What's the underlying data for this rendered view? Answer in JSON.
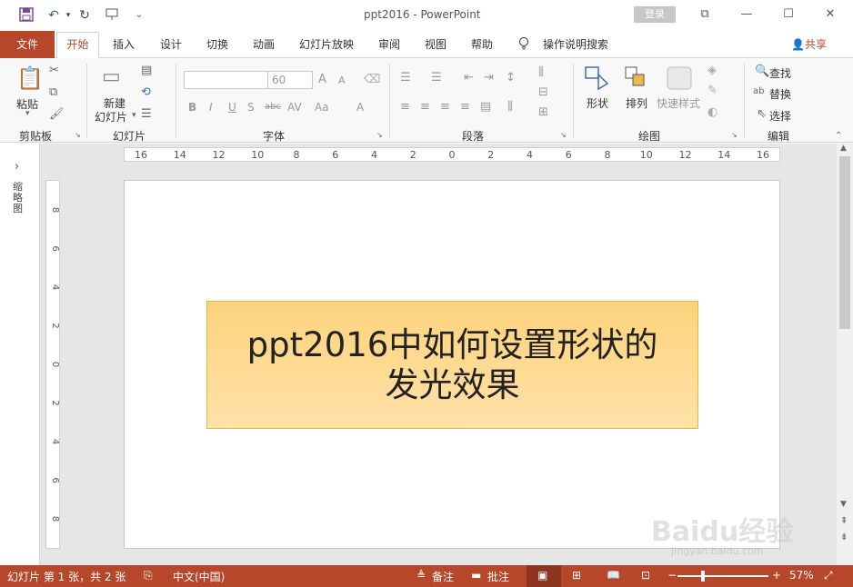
{
  "window": {
    "title": "ppt2016  -  PowerPoint",
    "login_label": "登录",
    "controls": {
      "restore": "⧉",
      "minimize": "—",
      "maximize": "☐",
      "close": "✕"
    }
  },
  "quick_access": {
    "save_icon": "save-icon",
    "undo_icon": "undo-icon",
    "redo_icon": "redo-icon",
    "present_icon": "present-icon",
    "customize": "⌄"
  },
  "tabs": {
    "file": "文件",
    "active": "开始",
    "items": [
      "插入",
      "设计",
      "切换",
      "动画",
      "幻灯片放映",
      "审阅",
      "视图",
      "帮助"
    ],
    "tell_me": "操作说明搜索",
    "share": "共享"
  },
  "ribbon": {
    "clipboard": {
      "paste": "粘贴",
      "label": "剪贴板"
    },
    "slides": {
      "new_slide_line1": "新建",
      "new_slide_line2": "幻灯片",
      "label": "幻灯片"
    },
    "font": {
      "font_name": "",
      "font_size": "60",
      "bold": "B",
      "italic": "I",
      "underline": "U",
      "shadow": "S",
      "strike": "abc",
      "spacing": "AV",
      "case": "Aa",
      "color": "A",
      "grow": "A",
      "shrink": "A",
      "label": "字体"
    },
    "paragraph": {
      "label": "段落"
    },
    "drawing": {
      "shapes": "形状",
      "arrange": "排列",
      "quick_styles": "快速样式",
      "label": "绘图"
    },
    "editing": {
      "find": "查找",
      "replace": "替换",
      "select": "选择",
      "label": "编辑"
    }
  },
  "rulers": {
    "horizontal_ticks": [
      "16",
      "14",
      "12",
      "10",
      "8",
      "6",
      "4",
      "2",
      "0",
      "2",
      "4",
      "6",
      "8",
      "10",
      "12",
      "14",
      "16"
    ],
    "vertical_ticks": [
      "8",
      "6",
      "4",
      "2",
      "0",
      "2",
      "4",
      "6",
      "8"
    ]
  },
  "thumbnails": {
    "label": "缩略图",
    "expand": "›"
  },
  "slide": {
    "shape_text": "ppt2016中如何设置形状的\n发光效果"
  },
  "status": {
    "slide_info": "幻灯片 第 1 张，共 2 张",
    "language": "中文(中国)",
    "notes": "备注",
    "comments": "批注",
    "zoom_minus": "−",
    "zoom_plus": "+",
    "zoom": "57%"
  },
  "watermark": {
    "text": "Baidu经验",
    "url": "jingyan.baidu.com"
  },
  "colors": {
    "accent": "#b7472a",
    "shape_fill": "#fdd27c"
  }
}
